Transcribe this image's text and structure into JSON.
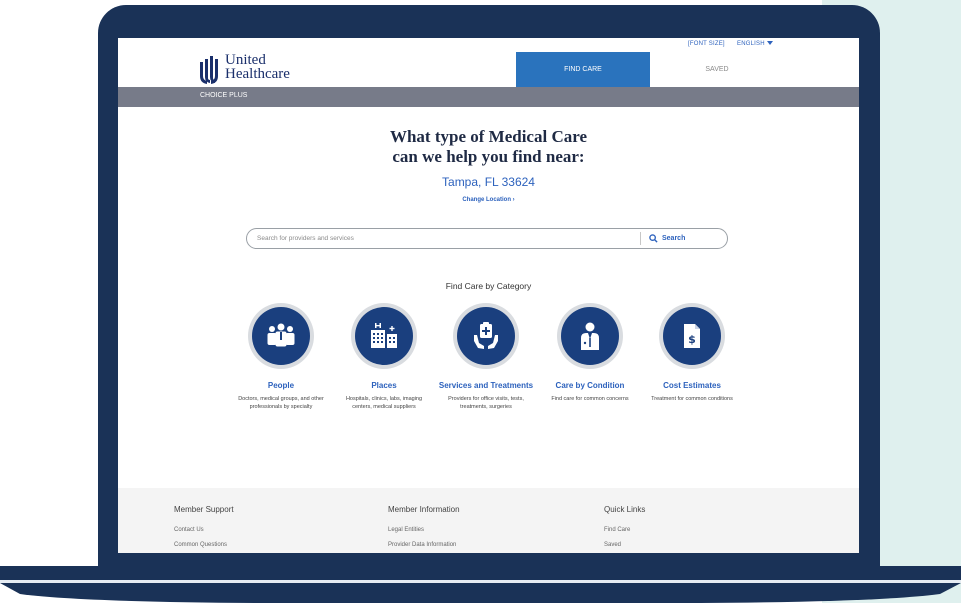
{
  "header": {
    "utility_font": "[FONT SIZE]",
    "utility_lang": "ENGLISH",
    "logo_line1": "United",
    "logo_line2": "Healthcare",
    "nav_find": "FIND CARE",
    "nav_saved": "SAVED"
  },
  "plan": {
    "name": "CHOICE PLUS"
  },
  "hero": {
    "line1": "What type of Medical Care",
    "line2": "can we help you find near:",
    "location": "Tampa, FL 33624",
    "change_location": "Change Location ›"
  },
  "search": {
    "placeholder": "Search for providers and services",
    "button": "Search"
  },
  "categories": {
    "title": "Find Care by Category",
    "items": [
      {
        "label": "People",
        "desc": "Doctors, medical groups, and other professionals by specialty",
        "icon": "people-icon"
      },
      {
        "label": "Places",
        "desc": "Hospitals, clinics, labs, imaging centers, medical suppliers",
        "icon": "buildings-icon"
      },
      {
        "label": "Services and Treatments",
        "desc": "Providers for office visits, tests, treatments, surgeries",
        "icon": "medical-kit-hands-icon"
      },
      {
        "label": "Care by Condition",
        "desc": "Find care for common concerns",
        "icon": "doctor-icon"
      },
      {
        "label": "Cost Estimates",
        "desc": "Treatment for common conditions",
        "icon": "dollar-document-icon"
      }
    ]
  },
  "footer": {
    "support": {
      "title": "Member Support",
      "links": [
        "Contact Us",
        "Common Questions"
      ]
    },
    "info": {
      "title": "Member Information",
      "links": [
        "Legal Entities",
        "Provider Data Information"
      ]
    },
    "quick": {
      "title": "Quick Links",
      "links": [
        "Find Care",
        "Saved"
      ]
    }
  },
  "colors": {
    "frame": "#1a3257",
    "accent": "#2a73bd",
    "icon_disc": "#1a3f7e",
    "plan_bar": "#777b89",
    "side_panel": "#dff0ee"
  }
}
